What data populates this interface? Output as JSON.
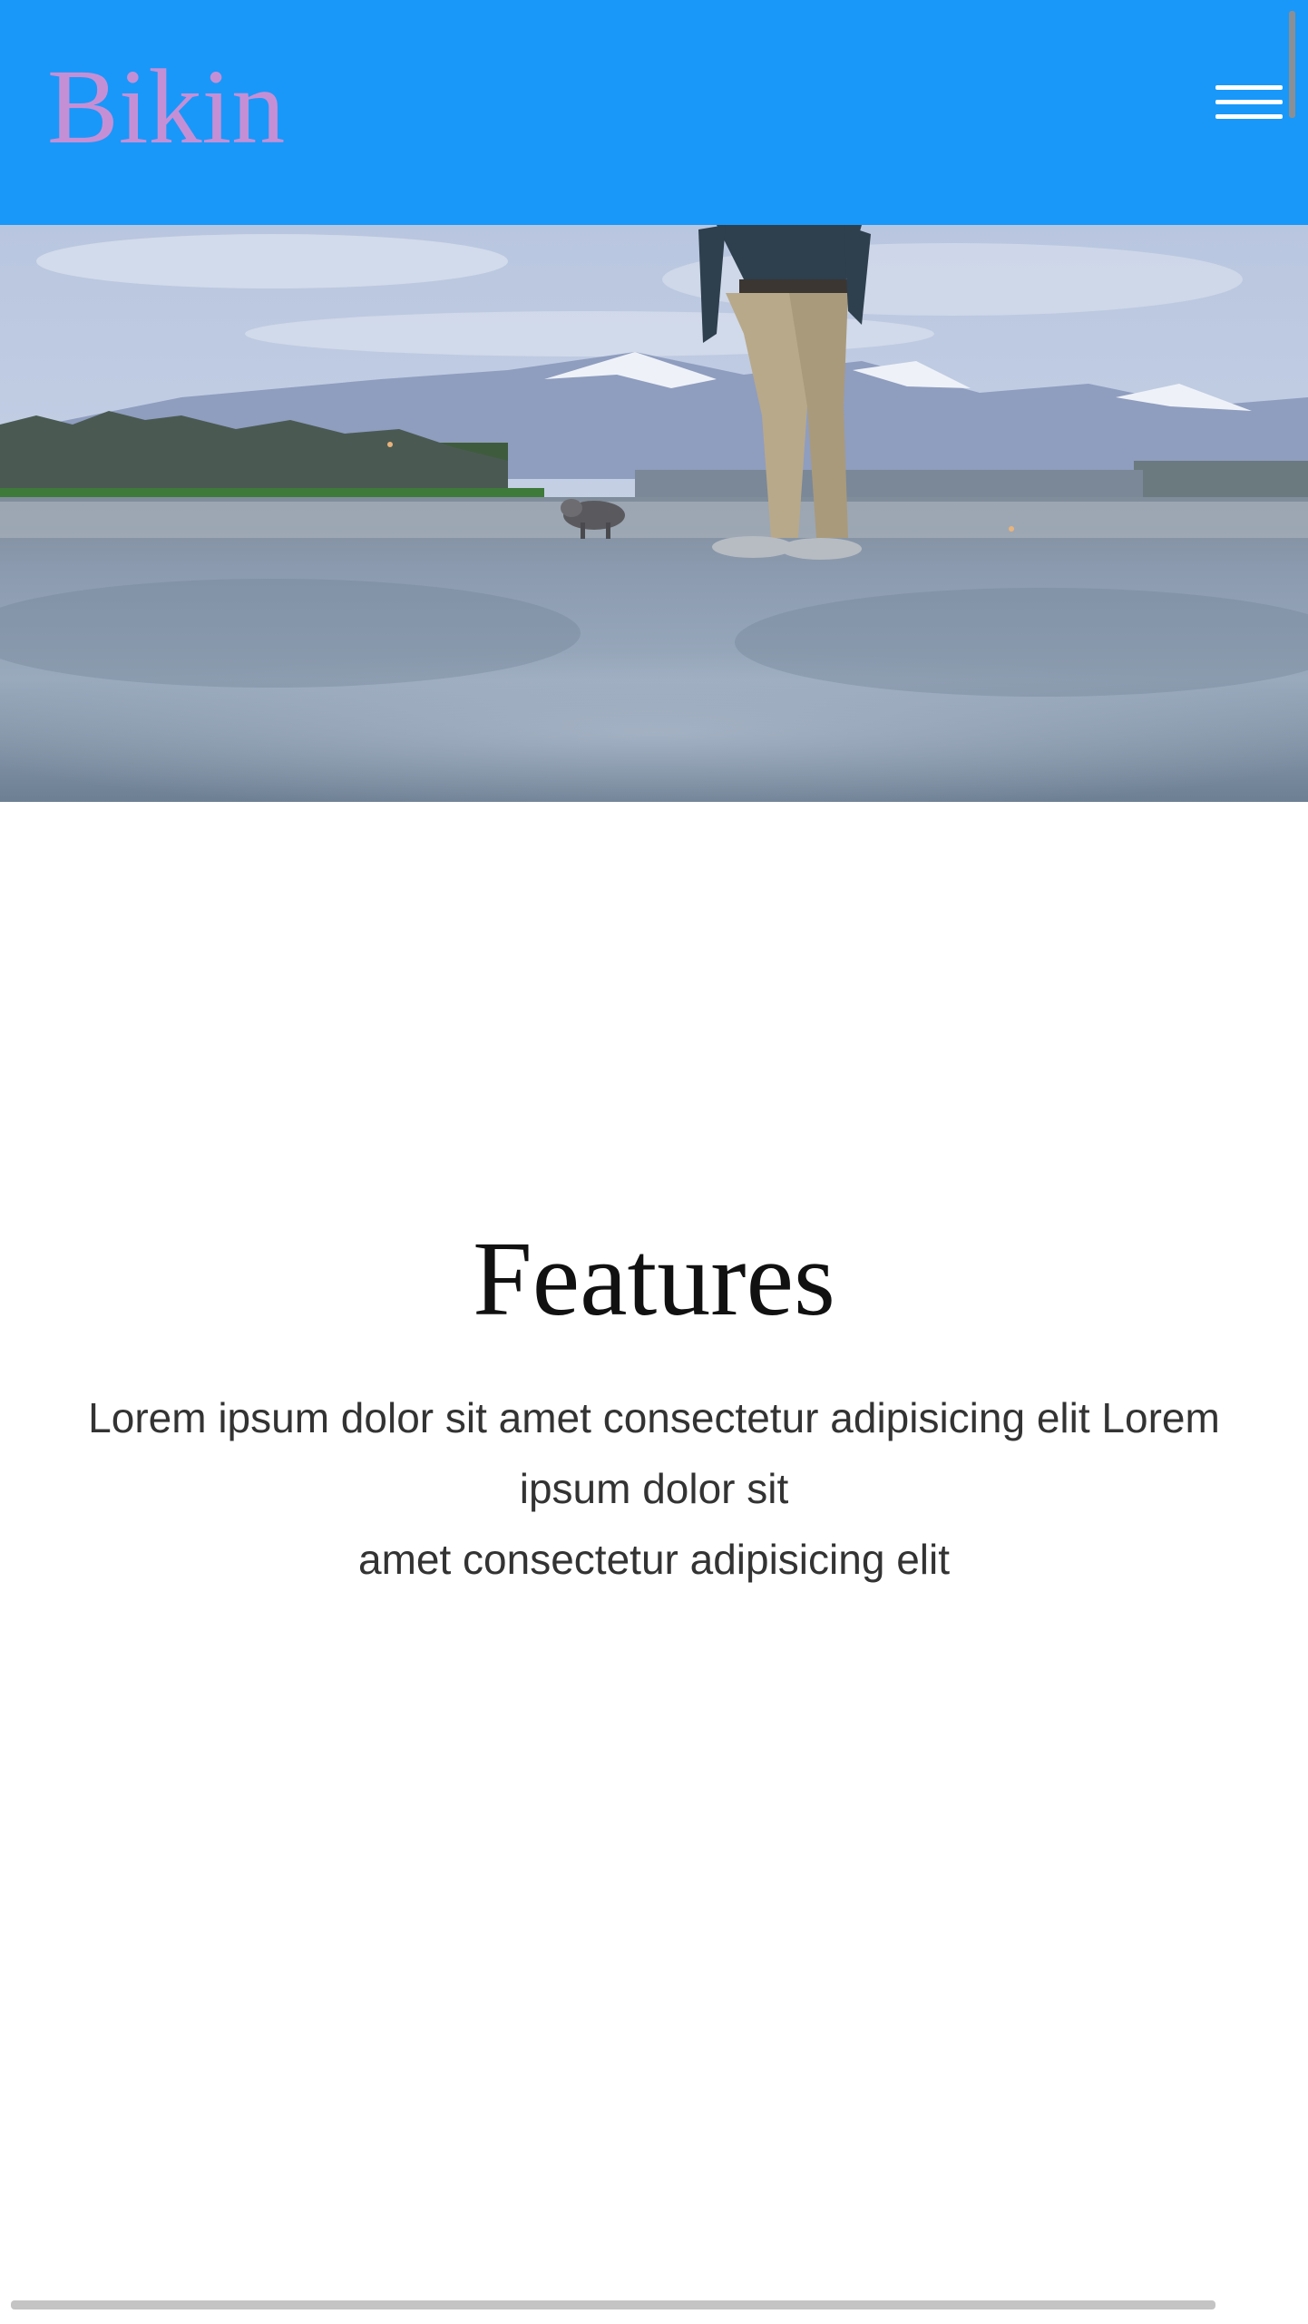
{
  "header": {
    "logo_text": "Bikin",
    "logo_color": "#c58fd6",
    "background_color": "#1998f9",
    "menu_icon": "hamburger-menu-icon"
  },
  "hero": {
    "image_description_icon": "hero-photo"
  },
  "features": {
    "title": "Features",
    "paragraph_line_1": "Lorem ipsum dolor sit amet consectetur adipisicing elit Lorem ipsum dolor sit",
    "paragraph_line_2": "amet consectetur adipisicing elit"
  }
}
